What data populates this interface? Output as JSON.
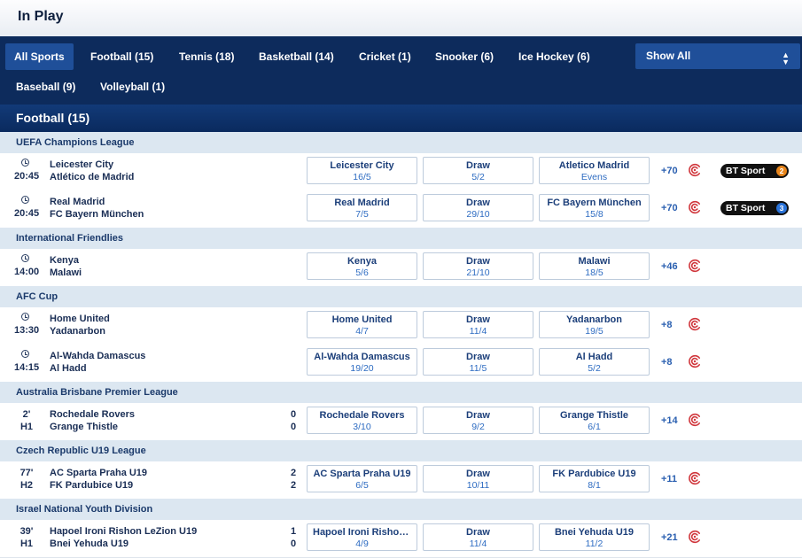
{
  "header": {
    "title": "In Play"
  },
  "nav": {
    "tabs": [
      {
        "label": "All Sports",
        "active": true
      },
      {
        "label": "Football (15)"
      },
      {
        "label": "Tennis (18)"
      },
      {
        "label": "Basketball (14)"
      },
      {
        "label": "Cricket (1)"
      },
      {
        "label": "Snooker (6)"
      },
      {
        "label": "Ice Hockey (6)"
      },
      {
        "label": "Baseball (9)"
      },
      {
        "label": "Volleyball (1)"
      }
    ],
    "filter": {
      "label": "Show All"
    }
  },
  "sport": {
    "title": "Football (15)"
  },
  "leagues": [
    {
      "name": "UEFA Champions League"
    },
    {
      "name": "International Friendlies"
    },
    {
      "name": "AFC Cup"
    },
    {
      "name": "Australia Brisbane Premier League"
    },
    {
      "name": "Czech Republic U19 League"
    },
    {
      "name": "Israel National Youth Division"
    }
  ],
  "matches": [
    {
      "time": "20:45",
      "home": "Leicester City",
      "away": "Atlético de Madrid",
      "odds": [
        {
          "name": "Leicester City",
          "price": "16/5"
        },
        {
          "name": "Draw",
          "price": "5/2"
        },
        {
          "name": "Atletico Madrid",
          "price": "Evens"
        }
      ],
      "more": "+70",
      "tv": {
        "label": "BT Sport",
        "channel": "2",
        "color": "#e8851b"
      }
    },
    {
      "time": "20:45",
      "home": "Real Madrid",
      "away": "FC Bayern München",
      "odds": [
        {
          "name": "Real Madrid",
          "price": "7/5"
        },
        {
          "name": "Draw",
          "price": "29/10"
        },
        {
          "name": "FC Bayern München",
          "price": "15/8"
        }
      ],
      "more": "+70",
      "tv": {
        "label": "BT Sport",
        "channel": "3",
        "color": "#2a73d9"
      }
    },
    {
      "time": "14:00",
      "home": "Kenya",
      "away": "Malawi",
      "odds": [
        {
          "name": "Kenya",
          "price": "5/6"
        },
        {
          "name": "Draw",
          "price": "21/10"
        },
        {
          "name": "Malawi",
          "price": "18/5"
        }
      ],
      "more": "+46"
    },
    {
      "time": "13:30",
      "home": "Home United",
      "away": "Yadanarbon",
      "odds": [
        {
          "name": "Home United",
          "price": "4/7"
        },
        {
          "name": "Draw",
          "price": "11/4"
        },
        {
          "name": "Yadanarbon",
          "price": "19/5"
        }
      ],
      "more": "+8"
    },
    {
      "time": "14:15",
      "home": "Al-Wahda Damascus",
      "away": "Al Hadd",
      "odds": [
        {
          "name": "Al-Wahda Damascus",
          "price": "19/20"
        },
        {
          "name": "Draw",
          "price": "11/5"
        },
        {
          "name": "Al Hadd",
          "price": "5/2"
        }
      ],
      "more": "+8"
    },
    {
      "minute": "2'",
      "period": "H1",
      "home": "Rochedale Rovers",
      "away": "Grange Thistle",
      "home_score": "0",
      "away_score": "0",
      "odds": [
        {
          "name": "Rochedale Rovers",
          "price": "3/10"
        },
        {
          "name": "Draw",
          "price": "9/2"
        },
        {
          "name": "Grange Thistle",
          "price": "6/1"
        }
      ],
      "more": "+14"
    },
    {
      "minute": "77'",
      "period": "H2",
      "home": "AC Sparta Praha U19",
      "away": "FK Pardubice U19",
      "home_score": "2",
      "away_score": "2",
      "odds": [
        {
          "name": "AC Sparta Praha U19",
          "price": "6/5"
        },
        {
          "name": "Draw",
          "price": "10/11"
        },
        {
          "name": "FK Pardubice U19",
          "price": "8/1"
        }
      ],
      "more": "+11"
    },
    {
      "minute": "39'",
      "period": "H1",
      "home": "Hapoel Ironi Rishon LeZion U19",
      "away": "Bnei Yehuda U19",
      "home_score": "1",
      "away_score": "0",
      "odds": [
        {
          "name": "Hapoel Ironi Rishon ...",
          "price": "4/9"
        },
        {
          "name": "Draw",
          "price": "11/4"
        },
        {
          "name": "Bnei Yehuda U19",
          "price": "11/2"
        }
      ],
      "more": "+21"
    }
  ],
  "colors": {
    "navy": "#0d2b5c",
    "accent": "#1f4f99",
    "live": "#d0363c",
    "league_bg": "#dce7f1"
  }
}
